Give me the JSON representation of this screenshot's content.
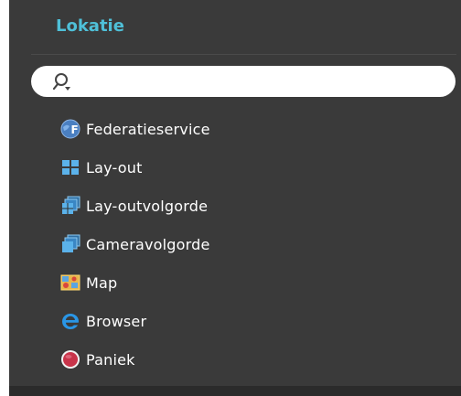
{
  "panel": {
    "title": "Lokatie",
    "search": {
      "placeholder": "",
      "value": ""
    },
    "items": [
      {
        "label": "Federatieservice",
        "icon": "federation-icon"
      },
      {
        "label": "Lay-out",
        "icon": "layout-icon"
      },
      {
        "label": "Lay-outvolgorde",
        "icon": "layout-sequence-icon"
      },
      {
        "label": "Cameravolgorde",
        "icon": "camera-sequence-icon"
      },
      {
        "label": "Map",
        "icon": "map-icon"
      },
      {
        "label": "Browser",
        "icon": "browser-icon"
      },
      {
        "label": "Paniek",
        "icon": "panic-icon"
      }
    ]
  },
  "colors": {
    "panel_bg": "#3a3a3a",
    "title": "#4fc0d8",
    "text": "#ffffff"
  }
}
